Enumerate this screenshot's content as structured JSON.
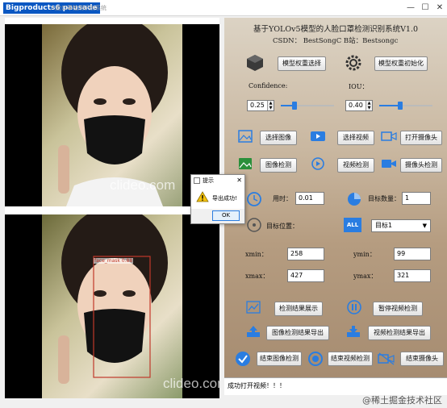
{
  "window": {
    "title": "Bigproducts6 pausade",
    "ghost_title": "人脸口罩检测识别系统",
    "minimize": "—",
    "maximize": "☐",
    "close": "✕"
  },
  "video": {
    "watermark_top": "clideo.com",
    "watermark_bottom": "clideo.com",
    "detection_label": "face_mask  0.88"
  },
  "header": {
    "title": "基于YOLOv5模型的人脸口罩检测识别系统V1.0",
    "credits": "CSDN：  BestSongC    B站：Bestsongc"
  },
  "model": {
    "select_button": "模型权重选择",
    "init_button": "模型权重初始化"
  },
  "params": {
    "confidence_label": "Confidence:",
    "iou_label": "IOU：",
    "confidence_value": "0.25",
    "iou_value": "0.40",
    "confidence_level": 0.25,
    "iou_level": 0.4
  },
  "actions": {
    "select_image": "选择图像",
    "select_video": "选择视频",
    "open_camera": "打开摄像头",
    "image_detect": "图像检测",
    "video_detect": "视频检测",
    "camera_detect": "摄像头检测"
  },
  "stats": {
    "time_label": "用时：",
    "time_value": "0.01",
    "count_label": "目标数量：",
    "count_value": "1",
    "position_label": "目标位置：",
    "target_selected": "目标1",
    "all_badge": "ALL"
  },
  "coords": {
    "xmin_label": "xmin：",
    "xmin_value": "258",
    "ymin_label": "ymin：",
    "ymin_value": "99",
    "xmax_label": "xmax：",
    "xmax_value": "427",
    "ymax_label": "ymax：",
    "ymax_value": "321"
  },
  "results": {
    "show_result": "检测结果展示",
    "pause_video": "暂停视频检测",
    "export_image": "图像检测结果导出",
    "export_video": "视频检测结果导出",
    "end_image": "结束图像检测",
    "end_video": "结束视频检测",
    "end_camera": "结束摄像头"
  },
  "status": {
    "message": "成功打开视频！！！"
  },
  "footer": {
    "watermark": "@稀土掘金技术社区"
  },
  "dialog": {
    "title": "提示",
    "message": "导出成功!",
    "ok": "OK"
  },
  "colors": {
    "accent": "#2a7de1",
    "title_bar": "#0a57c2",
    "detection_box": "#c0392b"
  }
}
